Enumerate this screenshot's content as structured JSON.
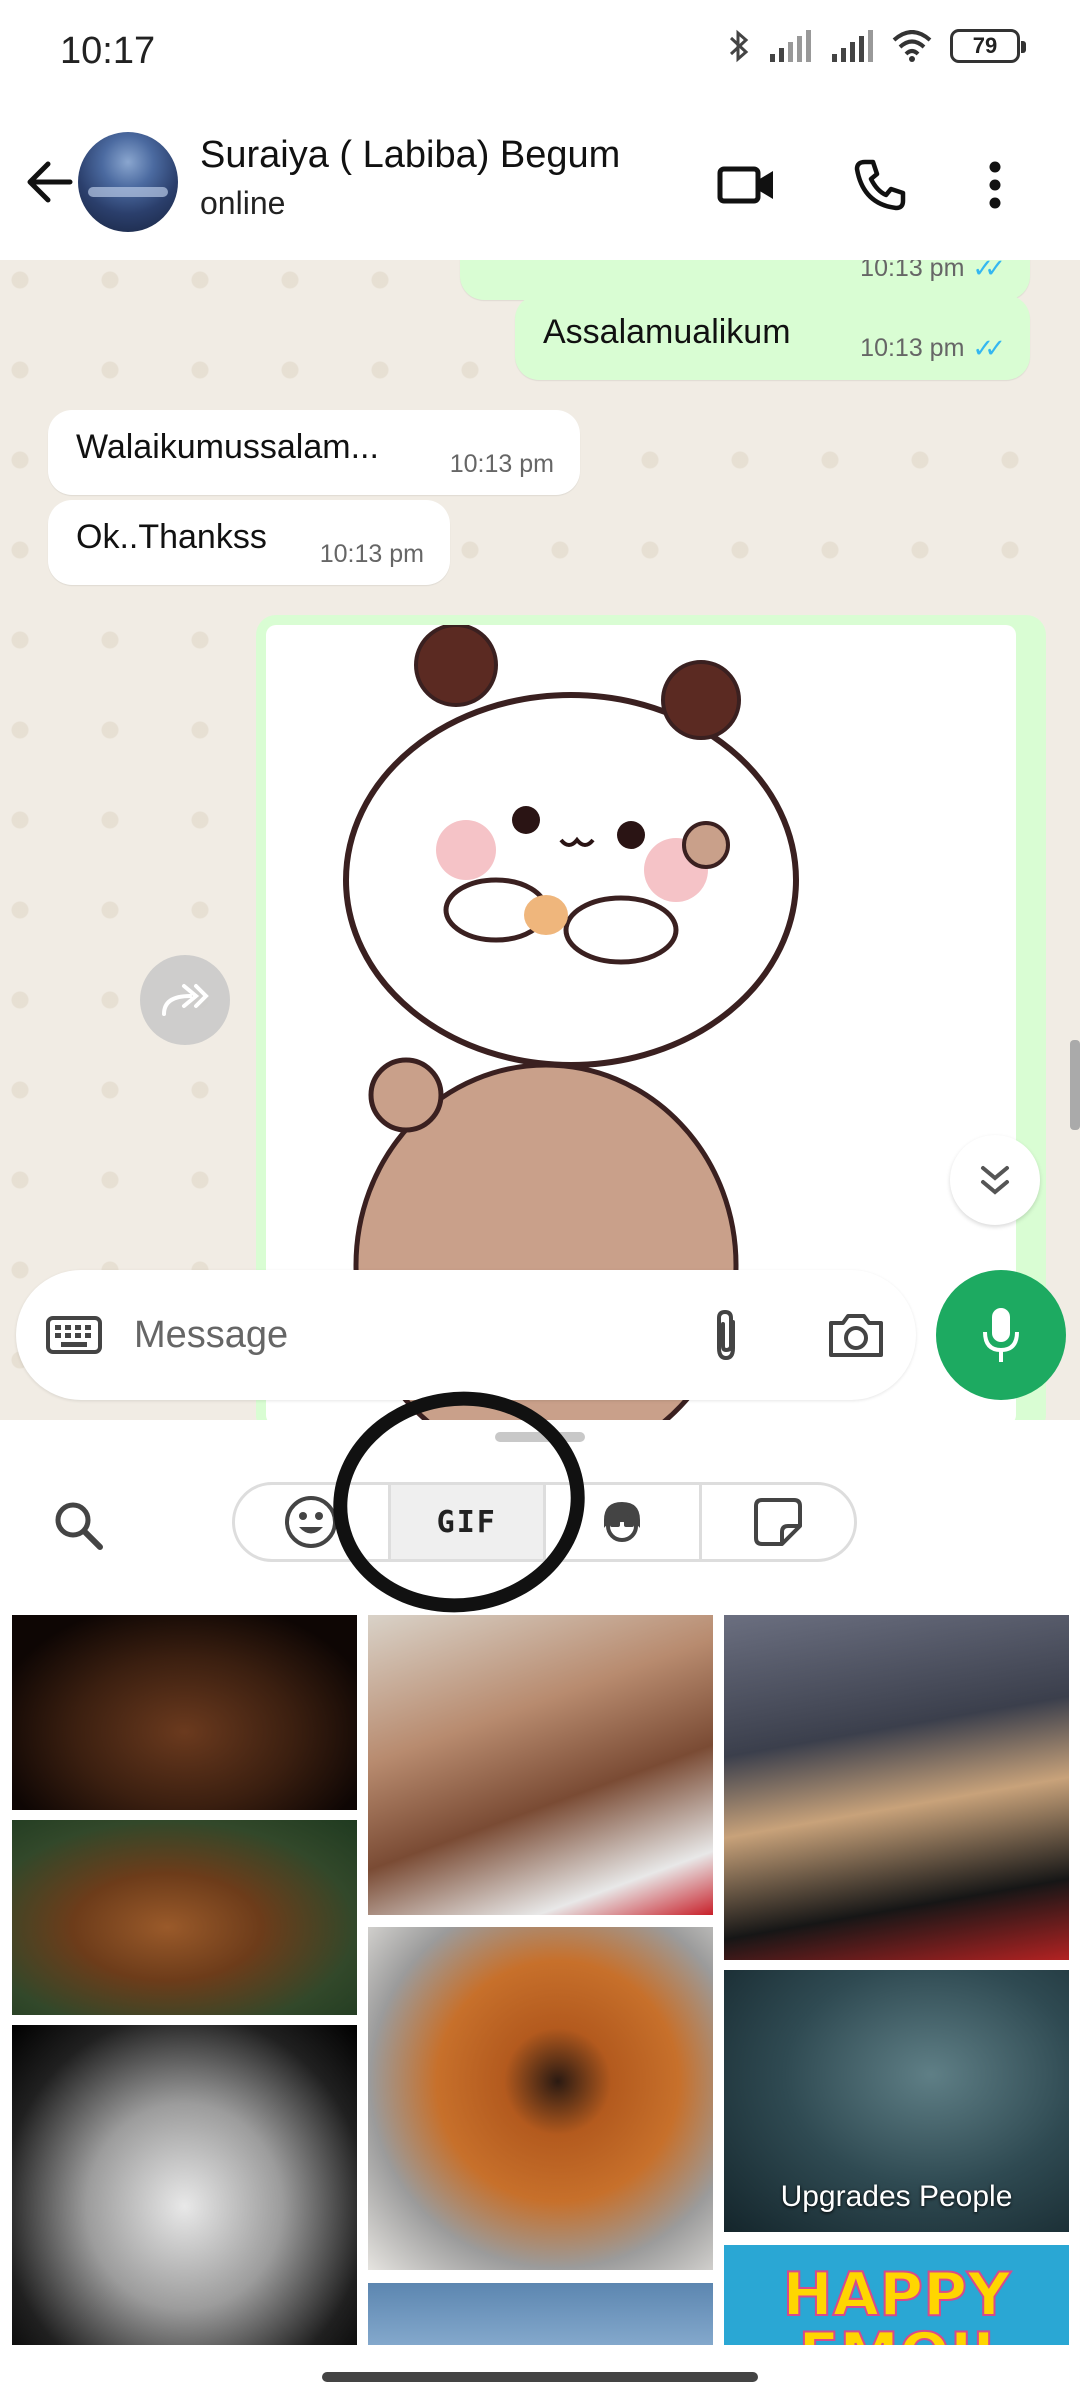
{
  "status_bar": {
    "time": "10:17",
    "battery": "79"
  },
  "header": {
    "contact_name": "Suraiya ( Labiba) Begum",
    "contact_status": "online"
  },
  "messages": [
    {
      "direction": "out",
      "text": "Assalamualikum",
      "time": "10:13 pm",
      "ticks": "✓✓"
    },
    {
      "direction": "in",
      "text": "Walaikumussalam...",
      "time": "10:13 pm"
    },
    {
      "direction": "in",
      "text": "Ok..Thankss",
      "time": "10:13 pm"
    }
  ],
  "partial_message_time": "10:13 pm",
  "input": {
    "placeholder": "Message"
  },
  "panel": {
    "tabs": [
      {
        "icon": "smiley-icon",
        "label": ""
      },
      {
        "icon": "gif-icon",
        "label": "GIF"
      },
      {
        "icon": "avatar-icon",
        "label": ""
      },
      {
        "icon": "sticker-icon",
        "label": ""
      }
    ],
    "selected_tab": "GIF"
  },
  "gifs": {
    "upgrades_caption": "Upgrades People",
    "happy_caption": "HAPPY EMOJI"
  },
  "colors": {
    "accent_green": "#1daa61",
    "outgoing_bubble": "#d9fdd3",
    "read_ticks": "#34b7f1",
    "chat_bg": "#f1ece4"
  }
}
